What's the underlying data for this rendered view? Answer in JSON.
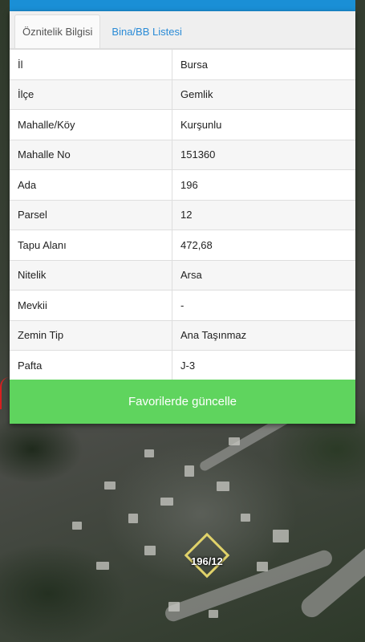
{
  "tabs": [
    {
      "label": "Öznitelik Bilgisi",
      "active": true
    },
    {
      "label": "Bina/BB Listesi",
      "active": false
    }
  ],
  "attributes": [
    {
      "key": "İl",
      "value": "Bursa"
    },
    {
      "key": "İlçe",
      "value": "Gemlik"
    },
    {
      "key": "Mahalle/Köy",
      "value": "Kurşunlu"
    },
    {
      "key": "Mahalle No",
      "value": "151360"
    },
    {
      "key": "Ada",
      "value": "196"
    },
    {
      "key": "Parsel",
      "value": "12"
    },
    {
      "key": "Tapu Alanı",
      "value": "472,68"
    },
    {
      "key": "Nitelik",
      "value": "Arsa"
    },
    {
      "key": "Mevkii",
      "value": "-"
    },
    {
      "key": "Zemin Tip",
      "value": "Ana Taşınmaz"
    },
    {
      "key": "Pafta",
      "value": "J-3"
    }
  ],
  "favorite_button": "Favorilerde güncelle",
  "map": {
    "parcel_label": "196/12"
  },
  "colors": {
    "accent": "#1a8fd6",
    "button": "#5fd45e",
    "parcel_outline": "#e0d26a"
  }
}
